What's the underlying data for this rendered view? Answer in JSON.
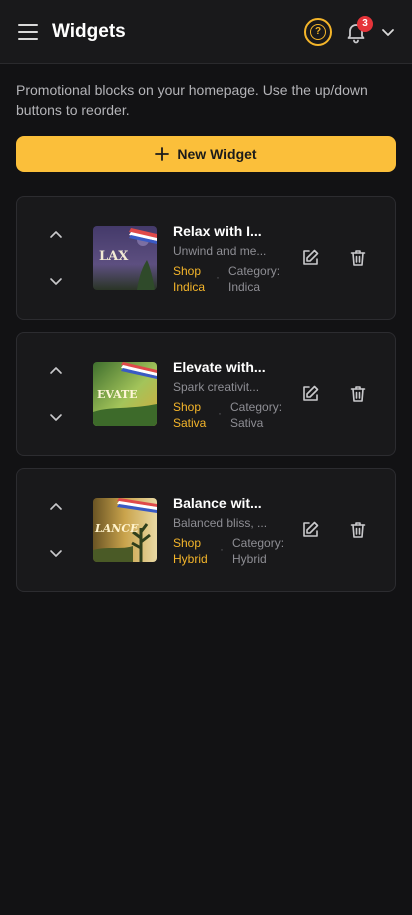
{
  "header": {
    "title": "Widgets",
    "help_icon_text": "?",
    "notification_count": "3"
  },
  "description": "Promotional blocks on your homepage. Use the up/down buttons to reorder.",
  "new_widget_label": "New Widget",
  "widgets": [
    {
      "title": "Relax with I...",
      "subtitle": "Unwind and me...",
      "shop_label": "Shop Indica",
      "category_label": "Category: Indica",
      "thumb_text": "LAX",
      "thumb_colors": [
        "#3a3550",
        "#6b5b8a",
        "#2d3a2e"
      ]
    },
    {
      "title": "Elevate with...",
      "subtitle": "Spark creativit...",
      "shop_label": "Shop Sativa",
      "category_label": "Category: Sativa",
      "thumb_text": "EVATE",
      "thumb_colors": [
        "#2f5a2a",
        "#8fb24a",
        "#d9b040"
      ]
    },
    {
      "title": "Balance wit...",
      "subtitle": "Balanced bliss, ...",
      "shop_label": "Shop Hybrid",
      "category_label": "Category: Hybrid",
      "thumb_text": "LANCE",
      "thumb_colors": [
        "#5a4a22",
        "#c9a246",
        "#2c3a1e"
      ]
    }
  ],
  "colors": {
    "accent": "#fbbf3a",
    "background": "#121214",
    "card": "#19191b",
    "badge": "#e5343a"
  }
}
